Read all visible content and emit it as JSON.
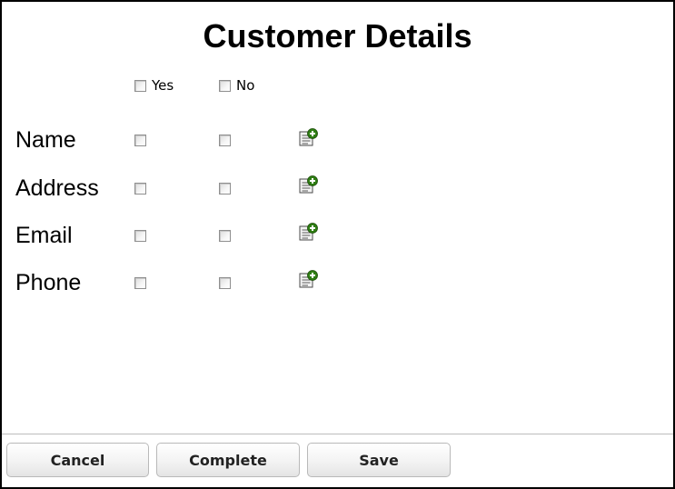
{
  "title": "Customer Details",
  "choices": {
    "yes_label": "Yes",
    "no_label": "No"
  },
  "rows": [
    {
      "label": "Name"
    },
    {
      "label": "Address"
    },
    {
      "label": "Email"
    },
    {
      "label": "Phone"
    }
  ],
  "buttons": {
    "cancel_label": "Cancel",
    "complete_label": "Complete",
    "save_label": "Save"
  },
  "icons": {
    "add_note": "note-add-icon"
  },
  "colors": {
    "add_icon_green": "#2e7d12",
    "divider": "#bdbdbd"
  }
}
